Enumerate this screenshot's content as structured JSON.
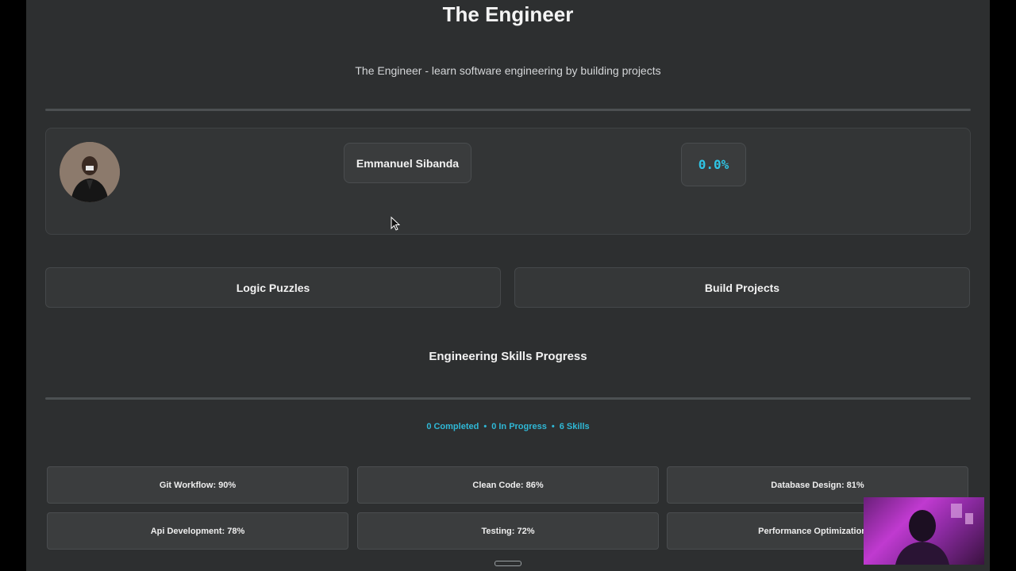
{
  "header": {
    "title": "The Engineer",
    "subtitle": "The Engineer - learn software engineering by building projects"
  },
  "profile": {
    "name": "Emmanuel Sibanda",
    "progress": "0.0%"
  },
  "actions": {
    "logic_puzzles": "Logic Puzzles",
    "build_projects": "Build Projects"
  },
  "skills_section": {
    "title": "Engineering Skills Progress",
    "stats": {
      "completed": "0 Completed",
      "in_progress": "0 In Progress",
      "skills": "6 Skills",
      "separator": "•"
    },
    "skills": [
      "Git Workflow: 90%",
      "Clean Code: 86%",
      "Database Design: 81%",
      "Api Development: 78%",
      "Testing: 72%",
      "Performance Optimization: 6"
    ]
  },
  "colors": {
    "accent": "#2fc4e4",
    "background": "#2d2f30",
    "card": "#333536"
  },
  "icons": {
    "cursor": "mouse-pointer-icon",
    "avatar": "user-avatar"
  }
}
